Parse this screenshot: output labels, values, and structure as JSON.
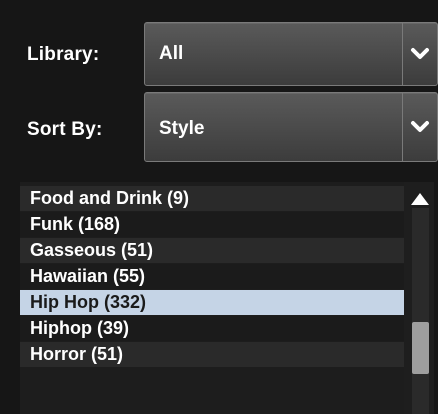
{
  "library": {
    "label": "Library:",
    "value": "All",
    "dropdown_icon": "chevron-down-icon"
  },
  "sort": {
    "label": "Sort By:",
    "value": "Style",
    "dropdown_icon": "chevron-down-icon"
  },
  "list": {
    "items": [
      {
        "label": "Food and Drink (9)"
      },
      {
        "label": "Funk (168)"
      },
      {
        "label": "Gasseous (51)"
      },
      {
        "label": "Hawaiian (55)"
      },
      {
        "label": "Hip Hop (332)"
      },
      {
        "label": "Hiphop (39)"
      },
      {
        "label": "Horror (51)"
      }
    ],
    "selected_index": 4
  },
  "scrollbar": {
    "up_icon": "triangle-up-icon"
  },
  "colors": {
    "background": "#161616",
    "selected_row": "#c5d4e6",
    "alt_row": "#2a2a2a",
    "select_bg": "#4a4a4a",
    "thumb": "#9e9e9e"
  }
}
